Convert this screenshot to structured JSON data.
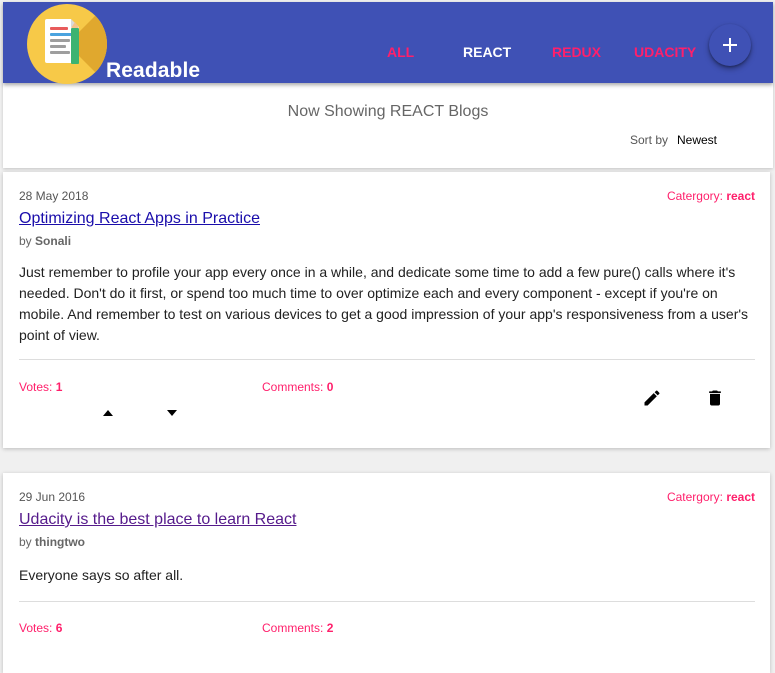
{
  "app": {
    "brand": "Readable"
  },
  "nav": [
    {
      "label": "ALL",
      "active": false
    },
    {
      "label": "REACT",
      "active": true
    },
    {
      "label": "REDUX",
      "active": false
    },
    {
      "label": "UDACITY",
      "active": false
    }
  ],
  "header": {
    "showing": "Now Showing REACT Blogs",
    "sort_label": "Sort by",
    "sort_value": "Newest"
  },
  "posts": [
    {
      "date": "28 May 2018",
      "category_label": "Catergory:",
      "category": "react",
      "title": "Optimizing React Apps in Practice",
      "author_prefix": "by",
      "author": "Sonali",
      "body": "Just remember to profile your app every once in a while, and dedicate some time to add a few pure() calls where it's needed. Don't do it first, or spend too much time to over optimize each and every component - except if you're on mobile. And remember to test on various devices to get a good impression of your app's responsiveness from a user's point of view.",
      "votes_label": "Votes:",
      "votes": "1",
      "comments_label": "Comments:",
      "comments": "0"
    },
    {
      "date": "29 Jun 2016",
      "category_label": "Catergory:",
      "category": "react",
      "title": "Udacity is the best place to learn React",
      "author_prefix": "by",
      "author": "thingtwo",
      "body": "Everyone says so after all.",
      "votes_label": "Votes:",
      "votes": "6",
      "comments_label": "Comments:",
      "comments": "2"
    }
  ],
  "icons": {
    "logo": "document-pencil-logo",
    "add": "plus-icon",
    "upvote": "arrow-up-icon",
    "downvote": "arrow-down-icon",
    "edit": "pencil-icon",
    "delete": "trash-icon"
  },
  "colors": {
    "appbar": "#3f51b5",
    "accent": "#ff1f6b",
    "link": "#1a0dab",
    "visited_link": "#551a8b",
    "logo_circle": "#f7c948"
  }
}
